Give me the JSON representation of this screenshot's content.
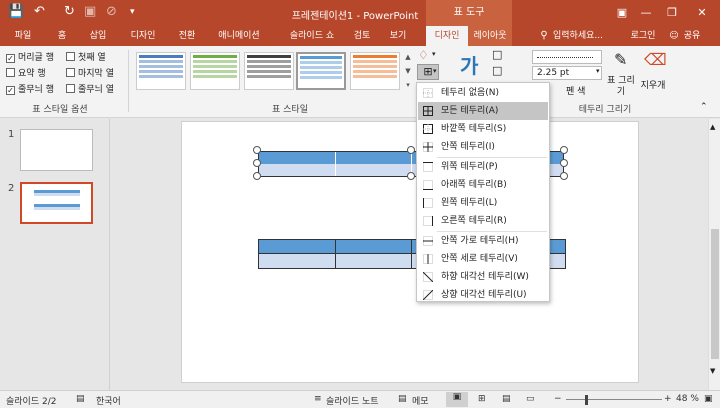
{
  "titlebar": {
    "title": "프레젠테이션1 - PowerPoint",
    "context_title": "표 도구",
    "save_icon": "save-icon",
    "undo_icon": "undo-icon",
    "redo_icon": "redo-icon"
  },
  "tabs": [
    {
      "label": "파일"
    },
    {
      "label": "홈"
    },
    {
      "label": "삽입"
    },
    {
      "label": "디자인"
    },
    {
      "label": "전환"
    },
    {
      "label": "애니메이션"
    },
    {
      "label": "슬라이드 쇼"
    },
    {
      "label": "검토"
    },
    {
      "label": "보기"
    },
    {
      "label": "디자인"
    },
    {
      "label": "레이아웃"
    }
  ],
  "tellme": "입력하세요...",
  "login": "로그인",
  "share": "공유",
  "style_options": {
    "header_row": "머리글 행",
    "first_col": "첫째 열",
    "total_row": "요약 행",
    "last_col": "마지막 열",
    "banded_rows": "줄무늬 행",
    "banded_cols": "줄무늬 열",
    "group_label": "표 스타일 옵션"
  },
  "table_styles": {
    "group_label": "표 스타일",
    "colors": [
      "#4a7ebb",
      "#70ad47",
      "#404040",
      "#5b9bd5",
      "#ed7d31"
    ]
  },
  "draw_borders": {
    "pen_weight": "2.25 pt",
    "pen_color_label": "펜 색",
    "draw_table": "표 그리기",
    "eraser": "지우개",
    "group_label": "테두리 그리기"
  },
  "border_menu": {
    "items": [
      {
        "label": "테두리 없음(N)"
      },
      {
        "label": "모든 테두리(A)"
      },
      {
        "label": "바깥쪽 테두리(S)"
      },
      {
        "label": "안쪽 테두리(I)"
      },
      {
        "label": "위쪽 테두리(P)"
      },
      {
        "label": "아래쪽 테두리(B)"
      },
      {
        "label": "왼쪽 테두리(L)"
      },
      {
        "label": "오른쪽 테두리(R)"
      },
      {
        "label": "안쪽 가로 테두리(H)"
      },
      {
        "label": "안쪽 세로 테두리(V)"
      },
      {
        "label": "하향 대각선 테두리(W)"
      },
      {
        "label": "상향 대각선 테두리(U)"
      }
    ]
  },
  "thumbnails": [
    {
      "number": "1"
    },
    {
      "number": "2"
    }
  ],
  "status": {
    "slide_info": "슬라이드 2/2",
    "language": "한국어",
    "notes": "슬라이드 노트",
    "comments": "메모",
    "zoom": "48 %"
  },
  "colors": {
    "brand": "#b7472a",
    "header_cell": "#5b9bd5",
    "band_cell": "#d0dcef"
  }
}
